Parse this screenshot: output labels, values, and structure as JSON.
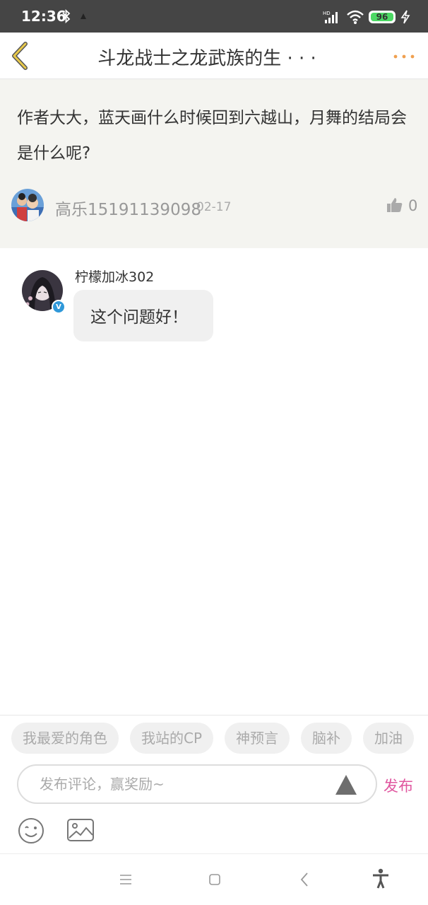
{
  "status_bar": {
    "time": "12:36",
    "battery": "96",
    "network_label": "HD",
    "icons": [
      "bluetooth-icon",
      "notification-icon",
      "signal-icon",
      "wifi-icon",
      "battery-icon",
      "charging-icon"
    ]
  },
  "header": {
    "title": "斗龙战士之龙武族的生 · · ·",
    "back_icon": "chevron-left-icon",
    "more_icon": "more-dots-icon",
    "accent_color": "#f0a050"
  },
  "question": {
    "text": "作者大大，蓝天画什么时候回到六越山，月舞的结局会是什么呢?",
    "author": "高乐15191139098",
    "date": "02-17",
    "likes": "0"
  },
  "answer": {
    "author": "柠檬加冰302",
    "verified_mark": "V",
    "text": "这个问题好！"
  },
  "chips": [
    "我最爱的角色",
    "我站的CP",
    "神预言",
    "脑补",
    "加油"
  ],
  "comment": {
    "placeholder": "发布评论，赢奖励~",
    "publish_label": "发布",
    "publish_color": "#e0569f"
  },
  "nav_icons": [
    "menu-icon",
    "home-square-icon",
    "back-arrow-icon",
    "accessibility-icon"
  ]
}
